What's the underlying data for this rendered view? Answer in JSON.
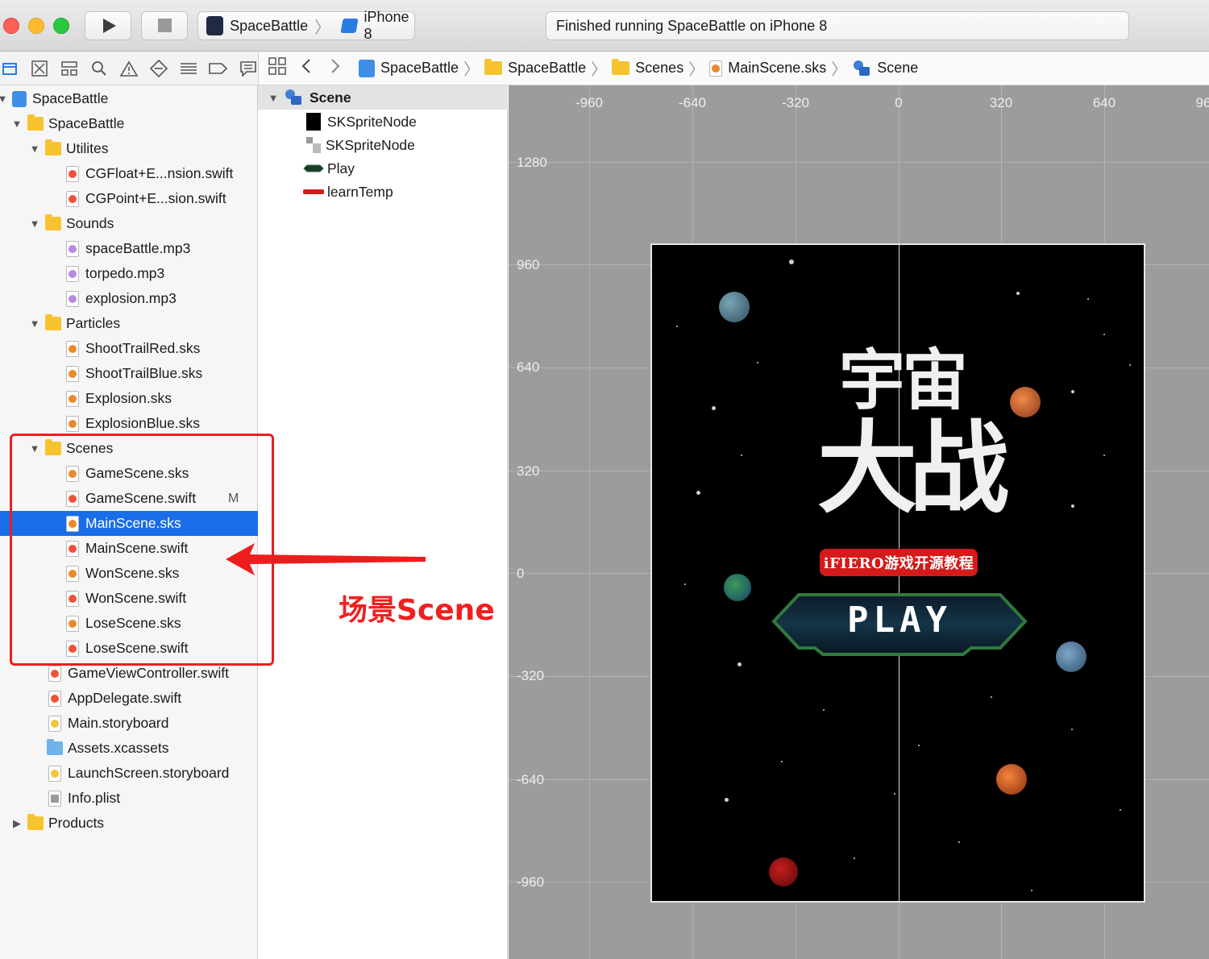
{
  "toolbar": {
    "scheme_project": "SpaceBattle",
    "scheme_device": "iPhone 8",
    "status": "Finished running SpaceBattle on iPhone 8"
  },
  "jump_bar": {
    "crumbs": [
      "SpaceBattle",
      "SpaceBattle",
      "Scenes",
      "MainScene.sks",
      "Scene"
    ]
  },
  "navigator": {
    "items": [
      {
        "label": "SpaceBattle",
        "kind": "project"
      },
      {
        "label": "SpaceBattle",
        "kind": "folder"
      },
      {
        "label": "Utilites",
        "kind": "folder"
      },
      {
        "label": "CGFloat+E...nsion.swift",
        "kind": "swift"
      },
      {
        "label": "CGPoint+E...sion.swift",
        "kind": "swift"
      },
      {
        "label": "Sounds",
        "kind": "folder"
      },
      {
        "label": "spaceBattle.mp3",
        "kind": "audio"
      },
      {
        "label": "torpedo.mp3",
        "kind": "audio"
      },
      {
        "label": "explosion.mp3",
        "kind": "audio"
      },
      {
        "label": "Particles",
        "kind": "folder"
      },
      {
        "label": "ShootTrailRed.sks",
        "kind": "sks"
      },
      {
        "label": "ShootTrailBlue.sks",
        "kind": "sks"
      },
      {
        "label": "Explosion.sks",
        "kind": "sks"
      },
      {
        "label": "ExplosionBlue.sks",
        "kind": "sks"
      },
      {
        "label": "Scenes",
        "kind": "folder"
      },
      {
        "label": "GameScene.sks",
        "kind": "sks"
      },
      {
        "label": "GameScene.swift",
        "kind": "swift",
        "badge": "M"
      },
      {
        "label": "MainScene.sks",
        "kind": "sks",
        "selected": true
      },
      {
        "label": "MainScene.swift",
        "kind": "swift"
      },
      {
        "label": "WonScene.sks",
        "kind": "sks"
      },
      {
        "label": "WonScene.swift",
        "kind": "swift"
      },
      {
        "label": "LoseScene.sks",
        "kind": "sks"
      },
      {
        "label": "LoseScene.swift",
        "kind": "swift"
      },
      {
        "label": "GameViewController.swift",
        "kind": "swift"
      },
      {
        "label": "AppDelegate.swift",
        "kind": "swift"
      },
      {
        "label": "Main.storyboard",
        "kind": "storyboard"
      },
      {
        "label": "Assets.xcassets",
        "kind": "assets"
      },
      {
        "label": "LaunchScreen.storyboard",
        "kind": "storyboard"
      },
      {
        "label": "Info.plist",
        "kind": "plist"
      },
      {
        "label": "Products",
        "kind": "folder"
      }
    ]
  },
  "outline": {
    "root": "Scene",
    "nodes": [
      "SKSpriteNode",
      "SKSpriteNode",
      "Play",
      "learnTemp"
    ]
  },
  "canvas": {
    "x_ticks": [
      "-960",
      "-640",
      "-320",
      "0",
      "320",
      "640",
      "96"
    ],
    "y_ticks": [
      "1280",
      "960",
      "640",
      "320",
      "0",
      "-320",
      "-640",
      "-960"
    ]
  },
  "scene_preview": {
    "title_line1": "宇宙",
    "title_line2": "大战",
    "banner": "iFIERO游戏开源教程",
    "play": "PLAY"
  },
  "annotation": {
    "label": "场景Scene",
    "color": "#ee1d1d"
  },
  "colors": {
    "selection": "#1a6de8",
    "folder": "#f7c430",
    "swift": "#f05138",
    "canvas": "#9c9c9c"
  }
}
